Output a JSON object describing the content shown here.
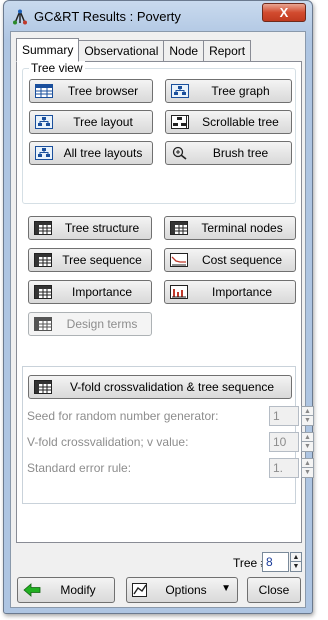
{
  "window": {
    "title": "GC&RT Results : Poverty",
    "close_glyph": "X"
  },
  "tabs": [
    {
      "label": "Summary",
      "active": true
    },
    {
      "label": "Observational",
      "active": false
    },
    {
      "label": "Node",
      "active": false
    },
    {
      "label": "Report",
      "active": false
    }
  ],
  "tree_view": {
    "group_label": "Tree view",
    "buttons": [
      {
        "label": "Tree browser",
        "icon": "tree-browser-icon"
      },
      {
        "label": "Tree graph",
        "icon": "tree-graph-icon"
      },
      {
        "label": "Tree layout",
        "icon": "tree-layout-icon"
      },
      {
        "label": "Scrollable tree",
        "icon": "scrollable-tree-icon"
      },
      {
        "label": "All tree layouts",
        "icon": "all-tree-layouts-icon"
      },
      {
        "label": "Brush tree",
        "icon": "brush-tree-icon"
      }
    ]
  },
  "results_buttons": [
    {
      "label": "Tree structure",
      "icon": "spreadsheet-icon"
    },
    {
      "label": "Terminal nodes",
      "icon": "spreadsheet-icon"
    },
    {
      "label": "Tree sequence",
      "icon": "spreadsheet-icon"
    },
    {
      "label": "Cost sequence",
      "icon": "cost-graph-icon"
    },
    {
      "label": "Importance",
      "icon": "spreadsheet-icon"
    },
    {
      "label": "Importance",
      "icon": "bar-graph-icon"
    },
    {
      "label": "Design terms",
      "icon": "spreadsheet-icon",
      "disabled": true
    }
  ],
  "vfold": {
    "button_label": "V-fold crossvalidation & tree sequence",
    "seed_label": "Seed for random number generator:",
    "seed_value": "1",
    "v_label": "V-fold crossvalidation; v value:",
    "v_value": "10",
    "se_label": "Standard error rule:",
    "se_value": "1."
  },
  "footer": {
    "tree_label": "Tree #:",
    "tree_value": "8",
    "modify_label": "Modify",
    "options_label": "Options",
    "close_label": "Close"
  }
}
